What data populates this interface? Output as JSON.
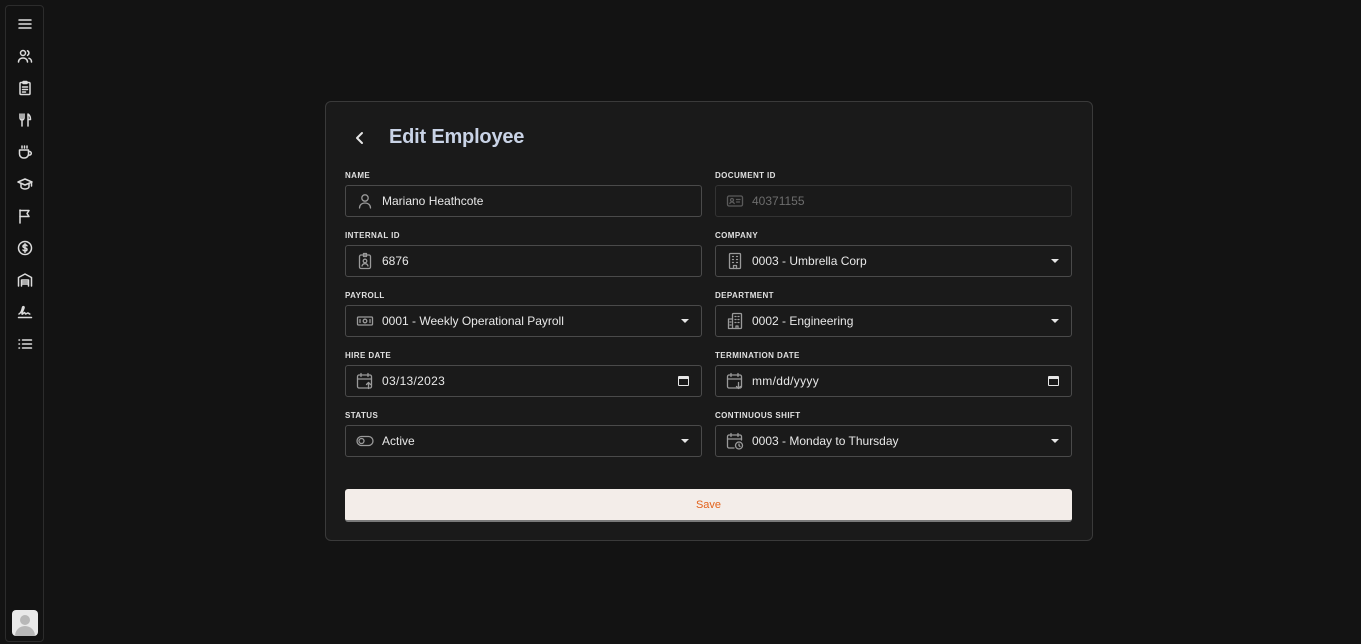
{
  "sidebar": {
    "items": [
      {
        "icon": "menu-icon"
      },
      {
        "icon": "users-icon"
      },
      {
        "icon": "clipboard-icon"
      },
      {
        "icon": "utensils-icon"
      },
      {
        "icon": "coffee-icon"
      },
      {
        "icon": "graduation-cap-icon"
      },
      {
        "icon": "flag-icon"
      },
      {
        "icon": "dollar-coin-icon"
      },
      {
        "icon": "warehouse-icon"
      },
      {
        "icon": "signature-icon"
      },
      {
        "icon": "list-icon"
      }
    ],
    "avatar": {
      "icon": "user-avatar-icon"
    }
  },
  "form": {
    "title": "Edit Employee",
    "fields": {
      "name": {
        "label": "NAME",
        "value": "Mariano Heathcote",
        "icon": "user-icon"
      },
      "document_id": {
        "label": "DOCUMENT ID",
        "value": "40371155",
        "icon": "id-card-icon",
        "disabled": true
      },
      "internal_id": {
        "label": "INTERNAL ID",
        "value": "6876",
        "icon": "badge-icon"
      },
      "company": {
        "label": "COMPANY",
        "value": "0003 - Umbrella Corp",
        "icon": "building-icon"
      },
      "payroll": {
        "label": "PAYROLL",
        "value": "0001 - Weekly Operational Payroll",
        "icon": "cash-icon"
      },
      "department": {
        "label": "DEPARTMENT",
        "value": "0002 - Engineering",
        "icon": "buildings-icon"
      },
      "hire_date": {
        "label": "HIRE DATE",
        "value": "03/13/2023",
        "icon": "calendar-up-icon"
      },
      "termination_date": {
        "label": "TERMINATION DATE",
        "value": "mm/dd/yyyy",
        "icon": "calendar-down-icon"
      },
      "status": {
        "label": "STATUS",
        "value": "Active",
        "icon": "toggle-icon"
      },
      "continuous_shift": {
        "label": "CONTINUOUS SHIFT",
        "value": "0003 - Monday to Thursday",
        "icon": "calendar-clock-icon"
      }
    },
    "save_label": "Save"
  },
  "colors": {
    "background": "#131313",
    "card": "#1a1a1a",
    "title": "#c9d3e6",
    "save_bg": "#f3ede9",
    "save_text": "#e2621b"
  }
}
